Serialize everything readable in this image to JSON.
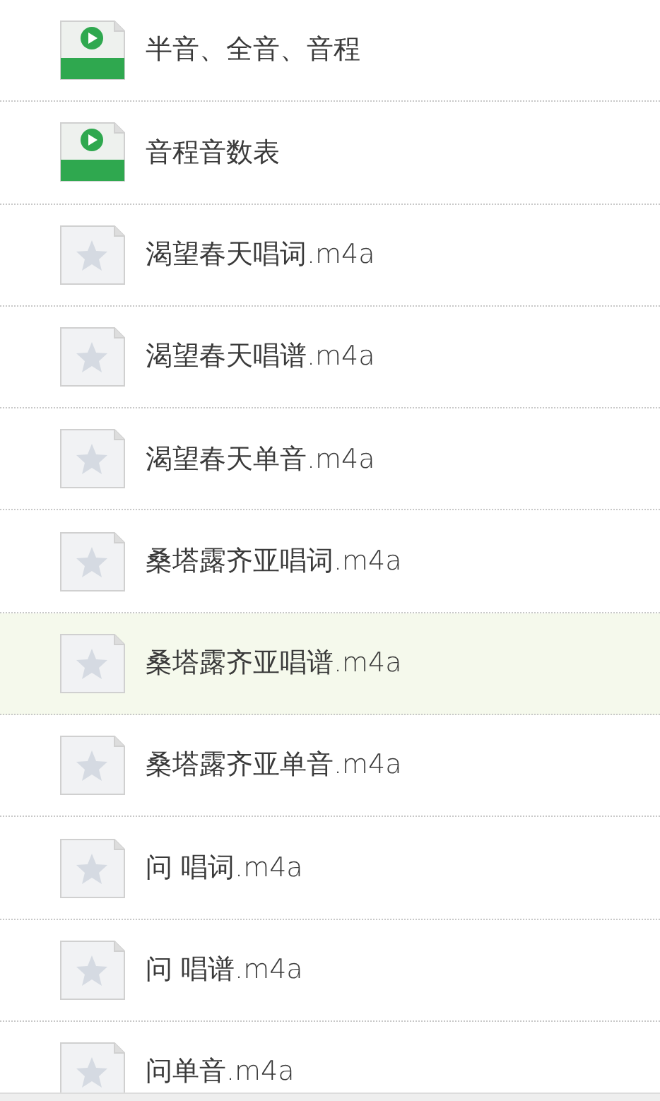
{
  "files": [
    {
      "name": "半音、全音、音程",
      "kind": "video",
      "selected": false
    },
    {
      "name": "音程音数表",
      "kind": "video",
      "selected": false
    },
    {
      "name": "渴望春天唱词.m4a",
      "kind": "audio",
      "selected": false
    },
    {
      "name": "渴望春天唱谱.m4a",
      "kind": "audio",
      "selected": false
    },
    {
      "name": "渴望春天单音.m4a",
      "kind": "audio",
      "selected": false
    },
    {
      "name": "桑塔露齐亚唱词.m4a",
      "kind": "audio",
      "selected": false
    },
    {
      "name": "桑塔露齐亚唱谱.m4a",
      "kind": "audio",
      "selected": true
    },
    {
      "name": "桑塔露齐亚单音.m4a",
      "kind": "audio",
      "selected": false
    },
    {
      "name": "问 唱词.m4a",
      "kind": "audio",
      "selected": false
    },
    {
      "name": "问 唱谱.m4a",
      "kind": "audio",
      "selected": false
    },
    {
      "name": "问单音.m4a",
      "kind": "audio",
      "selected": false
    }
  ]
}
